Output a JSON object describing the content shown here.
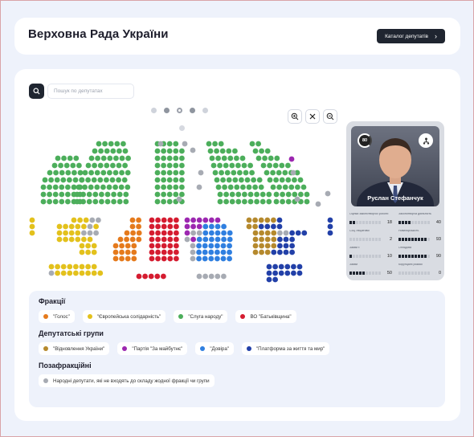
{
  "header": {
    "title": "Верховна Рада України",
    "catalog_label": "Каталог депутатів"
  },
  "search": {
    "placeholder": "Пошук по депутатах"
  },
  "colors": {
    "green": "#4cae5b",
    "grey": "#a7abb3",
    "yellow": "#e3c11c",
    "orange": "#e57a1c",
    "red": "#d51c30",
    "purple": "#9c27b0",
    "tan": "#b5892d",
    "lightblue": "#2f7fe0",
    "darkblue": "#2240a8"
  },
  "profile": {
    "name": "Руслан Стефанчук",
    "score": "80",
    "stats": [
      {
        "label": "Оцінка законотворчої роботи",
        "value": "18"
      },
      {
        "label": "Законотворча діяльність",
        "value": "40"
      },
      {
        "label": "Соц. ініціативи",
        "value": "2"
      },
      {
        "label": "Новаторськість",
        "value": "93"
      },
      {
        "label": "Заяви т.",
        "value": "10"
      },
      {
        "label": "Оглядова",
        "value": "90"
      },
      {
        "label": "Заяви",
        "value": "50"
      },
      {
        "label": "Корупційні ризики",
        "value": "0"
      }
    ]
  },
  "legend": {
    "factions_title": "Фракції",
    "factions": [
      {
        "label": "\"Голос\"",
        "color": "orange"
      },
      {
        "label": "\"Європейська солідарність\"",
        "color": "yellow"
      },
      {
        "label": "\"Слуга народу\"",
        "color": "green"
      },
      {
        "label": "ВО \"Батьківщина\"",
        "color": "red"
      }
    ],
    "groups_title": "Депутатські групи",
    "groups": [
      {
        "label": "\"Відновлення України\"",
        "color": "tan"
      },
      {
        "label": "\"Партія \"За майбутнє\"",
        "color": "purple"
      },
      {
        "label": "\"Довіра\"",
        "color": "lightblue"
      },
      {
        "label": "\"Платформа за життя та мир\"",
        "color": "darkblue"
      }
    ],
    "nonfaction_title": "Позафракційні",
    "nonfaction": [
      {
        "label": "Народні депутати, які не входять до складу жодної фракції чи групи",
        "color": "grey"
      }
    ]
  }
}
